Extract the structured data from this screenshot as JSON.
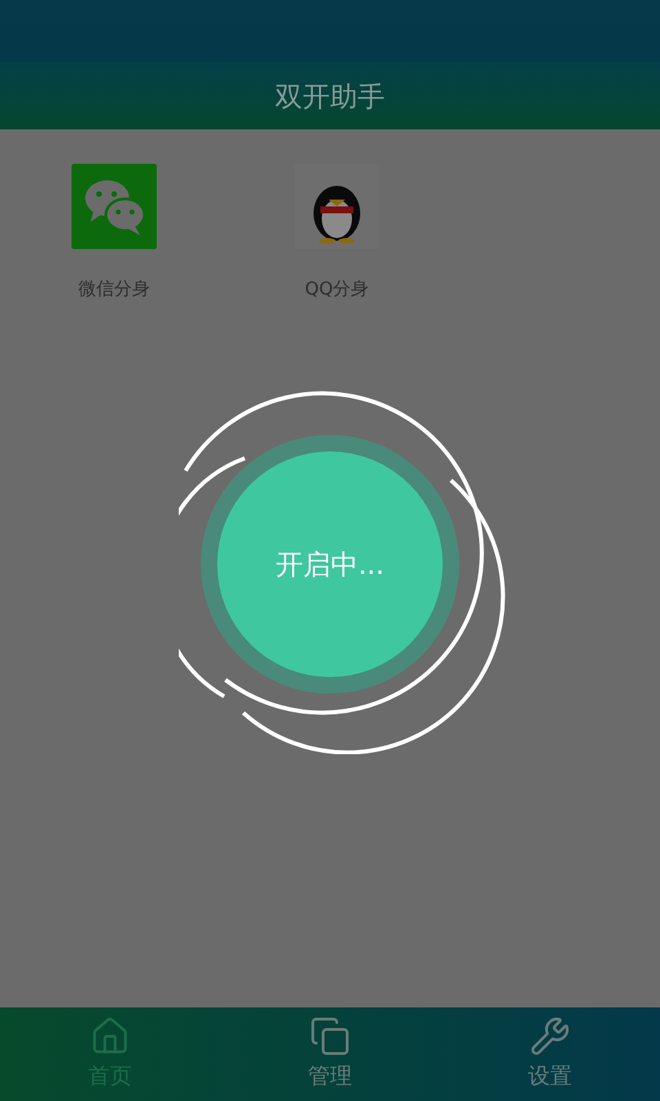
{
  "header": {
    "title": "双开助手"
  },
  "apps": [
    {
      "kind": "chat",
      "label": "微信分身"
    },
    {
      "kind": "bird",
      "label": "QQ分身"
    }
  ],
  "loading": {
    "text": "开启中..."
  },
  "nav": [
    {
      "kind": "home",
      "label": "首页",
      "selected": true
    },
    {
      "kind": "windows",
      "label": "管理",
      "selected": false
    },
    {
      "kind": "wrench",
      "label": "设置",
      "selected": false
    }
  ]
}
